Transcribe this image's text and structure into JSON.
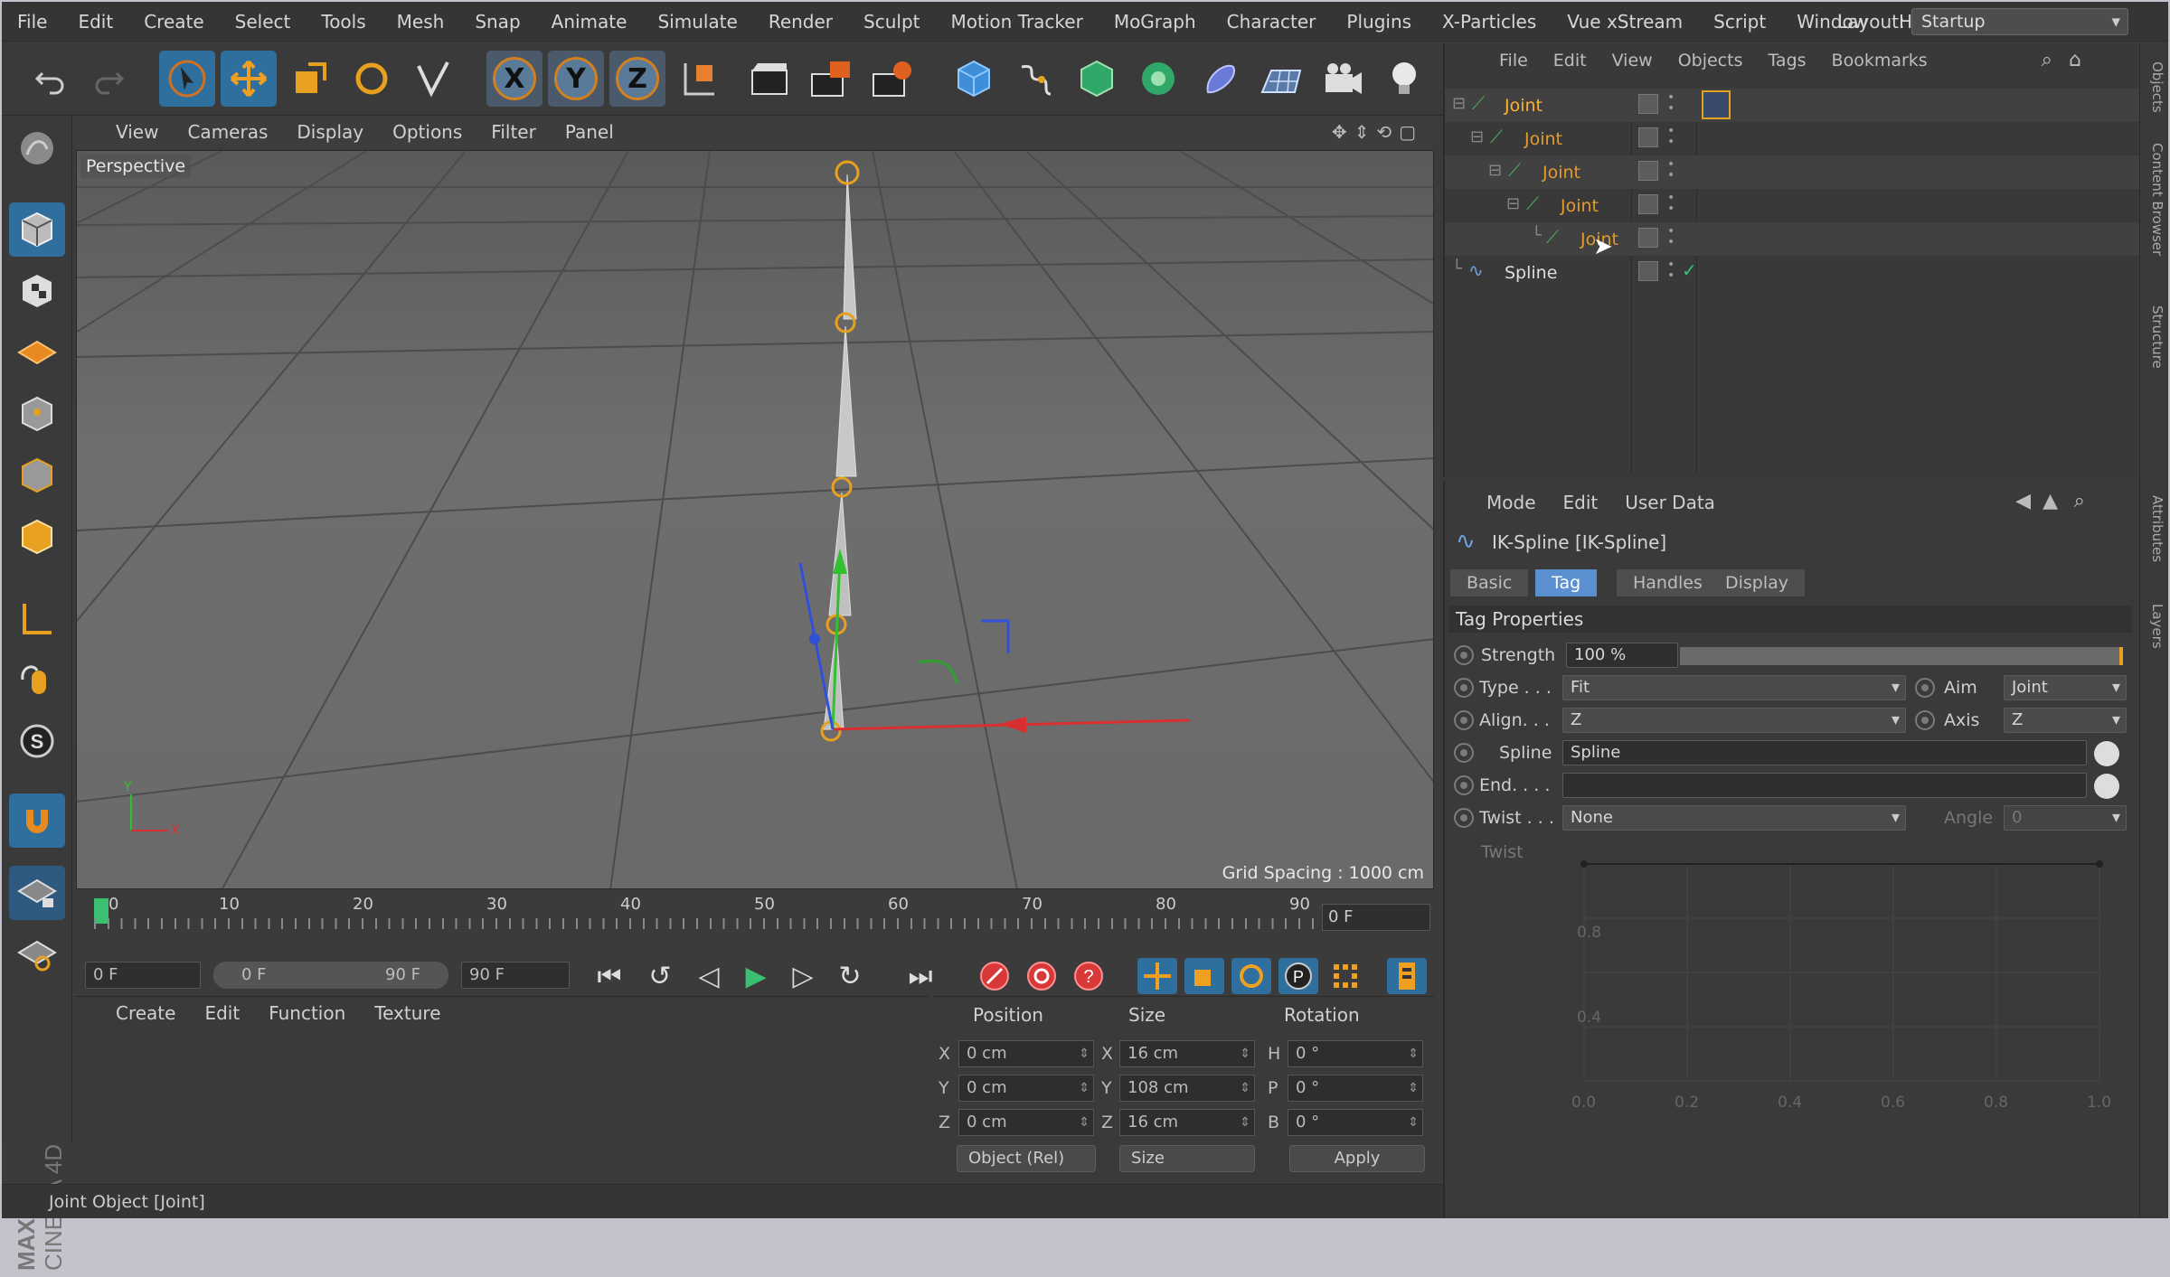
{
  "menubar": {
    "items": [
      "File",
      "Edit",
      "Create",
      "Select",
      "Tools",
      "Mesh",
      "Snap",
      "Animate",
      "Simulate",
      "Render",
      "Sculpt",
      "Motion Tracker",
      "MoGraph",
      "Character",
      "Plugins",
      "X-Particles",
      "Vue xStream",
      "Script",
      "Window",
      "Help"
    ],
    "layout_label": "Layout:",
    "layout_value": "Startup"
  },
  "toolbar": {
    "axis_x": "X",
    "axis_y": "Y",
    "axis_z": "Z"
  },
  "viewport": {
    "menu": [
      "View",
      "Cameras",
      "Display",
      "Options",
      "Filter",
      "Panel"
    ],
    "label": "Perspective",
    "grid_spacing": "Grid Spacing : 1000 cm",
    "axis_y": "Y",
    "axis_x": "X"
  },
  "timeline": {
    "ticks": [
      "0",
      "10",
      "20",
      "30",
      "40",
      "50",
      "60",
      "70",
      "80",
      "90"
    ],
    "current_frame": "0 F"
  },
  "transport": {
    "start_field": "0 F",
    "range_start": "0 F",
    "range_end": "90 F",
    "end_field": "90 F"
  },
  "material": {
    "menu": [
      "Create",
      "Edit",
      "Function",
      "Texture"
    ]
  },
  "coords": {
    "headers": [
      "Position",
      "Size",
      "Rotation"
    ],
    "pos_x": "0 cm",
    "pos_y": "0 cm",
    "pos_z": "0 cm",
    "size_x": "16 cm",
    "size_y": "108 cm",
    "size_z": "16 cm",
    "rot_h": "0 °",
    "rot_p": "0 °",
    "rot_b": "0 °",
    "mode_dropdown": "Object (Rel)",
    "size_dropdown": "Size",
    "apply": "Apply",
    "labels": {
      "x": "X",
      "y": "Y",
      "z": "Z",
      "h": "H",
      "p": "P",
      "b": "B"
    }
  },
  "status": "Joint Object [Joint]",
  "object_manager": {
    "menu": [
      "File",
      "Edit",
      "View",
      "Objects",
      "Tags",
      "Bookmarks"
    ],
    "rows": [
      {
        "name": "Joint"
      },
      {
        "name": "Joint"
      },
      {
        "name": "Joint"
      },
      {
        "name": "Joint"
      },
      {
        "name": "Joint"
      },
      {
        "name": "Spline"
      }
    ]
  },
  "attributes": {
    "menu": [
      "Mode",
      "Edit",
      "User Data"
    ],
    "title": "IK-Spline [IK-Spline]",
    "tabs": [
      "Basic",
      "Tag",
      "Handles",
      "Display"
    ],
    "active_tab": "Tag",
    "section": "Tag Properties",
    "strength_label": "Strength",
    "strength_value": "100 %",
    "type_label": "Type . . .",
    "type_value": "Fit",
    "aim_label": "Aim",
    "aim_value": "Joint",
    "align_label": "Align. . .",
    "align_value": "Z",
    "axis_label": "Axis",
    "axis_value": "Z",
    "spline_label": "Spline",
    "spline_value": "Spline",
    "end_label": "End. . . .",
    "twist_label": "Twist . . .",
    "twist_value": "None",
    "angle_label": "Angle",
    "angle_value": "0",
    "twist2_label": "Twist",
    "graph_y": [
      "0.8",
      "0.4"
    ],
    "graph_x": [
      "0.0",
      "0.2",
      "0.4",
      "0.6",
      "0.8",
      "1.0"
    ]
  },
  "side_tabs": [
    "Objects",
    "Content Browser",
    "Structure",
    "Attributes",
    "Layers"
  ],
  "brand": {
    "maxon": "MAXON",
    "product": "CINEMA 4D"
  },
  "colors": {
    "accent": "#2f6f9e",
    "joint_orange": "#e49b2a",
    "active_tab": "#5a8fd0"
  }
}
